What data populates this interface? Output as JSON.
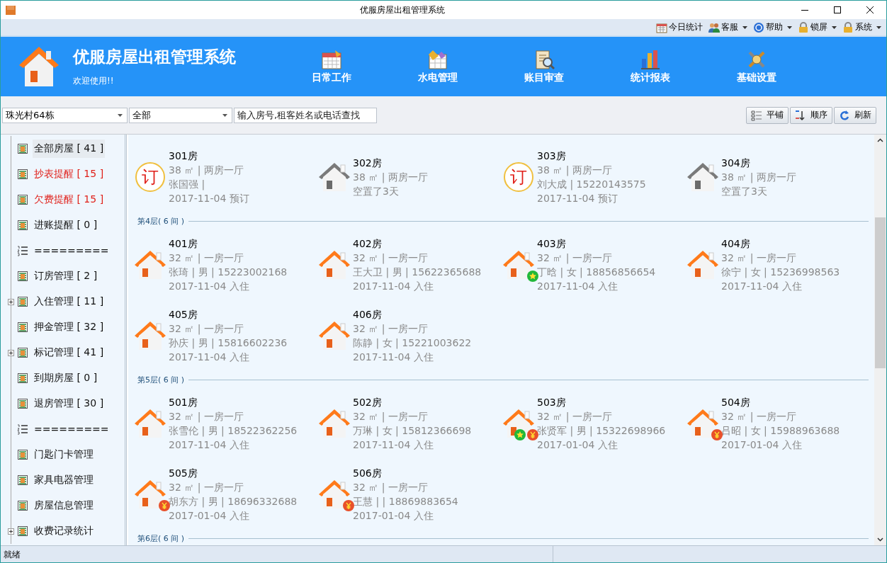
{
  "window": {
    "title": "优服房屋出租管理系统"
  },
  "menu": [
    {
      "label": "今日统计",
      "dropdown": false
    },
    {
      "label": "客服",
      "dropdown": true
    },
    {
      "label": "帮助",
      "dropdown": true
    },
    {
      "label": "锁屏",
      "dropdown": true
    },
    {
      "label": "系统",
      "dropdown": true
    }
  ],
  "header": {
    "title": "优服房屋出租管理系统",
    "subtitle": "欢迎使用!!",
    "nav": [
      {
        "label": "日常工作"
      },
      {
        "label": "水电管理"
      },
      {
        "label": "账目审查"
      },
      {
        "label": "统计报表"
      },
      {
        "label": "基础设置"
      }
    ]
  },
  "toolbar": {
    "building": "珠光村64栋",
    "filter": "全部",
    "search": {
      "placeholder": "输入房号,租客姓名或电话查找"
    },
    "buttons": [
      {
        "label": "平铺"
      },
      {
        "label": "顺序"
      },
      {
        "label": "刷新"
      }
    ]
  },
  "sidebar": {
    "items": [
      {
        "kind": "leaf",
        "label": "全部房屋 [ 41 ]",
        "alert": false,
        "selected": true
      },
      {
        "kind": "leaf",
        "label": "抄表提醒 [ 15 ]",
        "alert": true,
        "selected": false
      },
      {
        "kind": "leaf",
        "label": "欠费提醒 [ 15 ]",
        "alert": true,
        "selected": false
      },
      {
        "kind": "leaf",
        "label": "进账提醒 [ 0 ]",
        "alert": false,
        "selected": false
      },
      {
        "kind": "separator",
        "label": "=========",
        "alert": false,
        "selected": false
      },
      {
        "kind": "leaf",
        "label": "订房管理 [ 2 ]",
        "alert": false,
        "selected": false
      },
      {
        "kind": "collapsed",
        "label": "入住管理 [ 11 ]",
        "alert": false,
        "selected": false
      },
      {
        "kind": "leaf",
        "label": "押金管理 [ 32 ]",
        "alert": false,
        "selected": false
      },
      {
        "kind": "collapsed",
        "label": "标记管理 [ 41 ]",
        "alert": false,
        "selected": false
      },
      {
        "kind": "leaf",
        "label": "到期房屋 [ 0 ]",
        "alert": false,
        "selected": false
      },
      {
        "kind": "leaf",
        "label": "退房管理 [ 30 ]",
        "alert": false,
        "selected": false
      },
      {
        "kind": "separator",
        "label": "=========",
        "alert": false,
        "selected": false
      },
      {
        "kind": "leaf",
        "label": "门匙门卡管理",
        "alert": false,
        "selected": false
      },
      {
        "kind": "leaf",
        "label": "家具电器管理",
        "alert": false,
        "selected": false
      },
      {
        "kind": "leaf",
        "label": "房屋信息管理",
        "alert": false,
        "selected": false
      },
      {
        "kind": "collapsed",
        "label": "收费记录统计",
        "alert": false,
        "selected": false
      }
    ]
  },
  "floors": [
    {
      "rooms": [
        {
          "kind": "reserved",
          "mark": "订",
          "name": "301房",
          "lines": [
            "38 ㎡ | 两房一厅",
            "张国强 |",
            "2017-11-04 预订"
          ],
          "starred": false,
          "owing": false
        },
        {
          "kind": "vacant",
          "name": "302房",
          "lines": [
            "38 ㎡ | 两房一厅",
            "空置了3天"
          ],
          "starred": false,
          "owing": false
        },
        {
          "kind": "reserved",
          "mark": "订",
          "name": "303房",
          "lines": [
            "38 ㎡ | 两房一厅",
            "刘大成 | 15220143575",
            "2017-11-04 预订"
          ],
          "starred": false,
          "owing": false
        },
        {
          "kind": "vacant",
          "name": "304房",
          "lines": [
            "38 ㎡ | 两房一厅",
            "空置了3天"
          ],
          "starred": false,
          "owing": false
        }
      ]
    },
    {
      "heading": "第4层( 6 间 )",
      "rooms": [
        {
          "kind": "occupied",
          "name": "401房",
          "lines": [
            "32 ㎡ | 一房一厅",
            "张琦 | 男 | 15223002168",
            "2017-11-04 入住"
          ],
          "starred": false,
          "owing": false
        },
        {
          "kind": "occupied",
          "name": "402房",
          "lines": [
            "32 ㎡ | 一房一厅",
            "王大卫 | 男 | 15622365688",
            "2017-11-04 入住"
          ],
          "starred": false,
          "owing": false
        },
        {
          "kind": "occupied",
          "name": "403房",
          "lines": [
            "32 ㎡ | 一房一厅",
            "丁晗 | 女 | 18856856654",
            "2017-11-04 入住"
          ],
          "starred": true,
          "owing": false
        },
        {
          "kind": "occupied",
          "name": "404房",
          "lines": [
            "32 ㎡ | 一房一厅",
            "徐宁 | 女 | 15236998563",
            "2017-11-04 入住"
          ],
          "starred": false,
          "owing": false
        },
        {
          "kind": "occupied",
          "name": "405房",
          "lines": [
            "32 ㎡ | 一房一厅",
            "孙庆 | 男 | 15816602236",
            "2017-11-04 入住"
          ],
          "starred": false,
          "owing": false
        },
        {
          "kind": "occupied",
          "name": "406房",
          "lines": [
            "32 ㎡ | 一房一厅",
            "陈静 | 女 | 15221003622",
            "2017-11-04 入住"
          ],
          "starred": false,
          "owing": false
        }
      ]
    },
    {
      "heading": "第5层( 6 间 )",
      "rooms": [
        {
          "kind": "occupied",
          "name": "501房",
          "lines": [
            "32 ㎡ | 一房一厅",
            "张雪伦 | 男 | 18522362256",
            "2017-11-04 入住"
          ],
          "starred": false,
          "owing": false
        },
        {
          "kind": "occupied",
          "name": "502房",
          "lines": [
            "32 ㎡ | 一房一厅",
            "万琳 | 女 | 15812366698",
            "2017-11-04 入住"
          ],
          "starred": false,
          "owing": false
        },
        {
          "kind": "occupied",
          "name": "503房",
          "lines": [
            "32 ㎡ | 一房一厅",
            "张贤军 | 男 | 15322698966",
            "2017-01-04 入住"
          ],
          "starred": true,
          "owing": true
        },
        {
          "kind": "occupied",
          "name": "504房",
          "lines": [
            "32 ㎡ | 一房一厅",
            "吕昭 | 女 | 15988963688",
            "2017-01-04 入住"
          ],
          "starred": false,
          "owing": true
        },
        {
          "kind": "occupied",
          "name": "505房",
          "lines": [
            "32 ㎡ | 一房一厅",
            "胡东方 | 男 | 18696332688",
            "2017-01-04 入住"
          ],
          "starred": false,
          "owing": true
        },
        {
          "kind": "occupied",
          "name": "506房",
          "lines": [
            "32 ㎡ | 一房一厅",
            "王慧 |  | 18869883654",
            "2017-01-04 入住"
          ],
          "starred": false,
          "owing": true
        }
      ]
    },
    {
      "heading": "第6层( 6 间 )"
    }
  ],
  "status_bar": {
    "text": "就绪"
  }
}
